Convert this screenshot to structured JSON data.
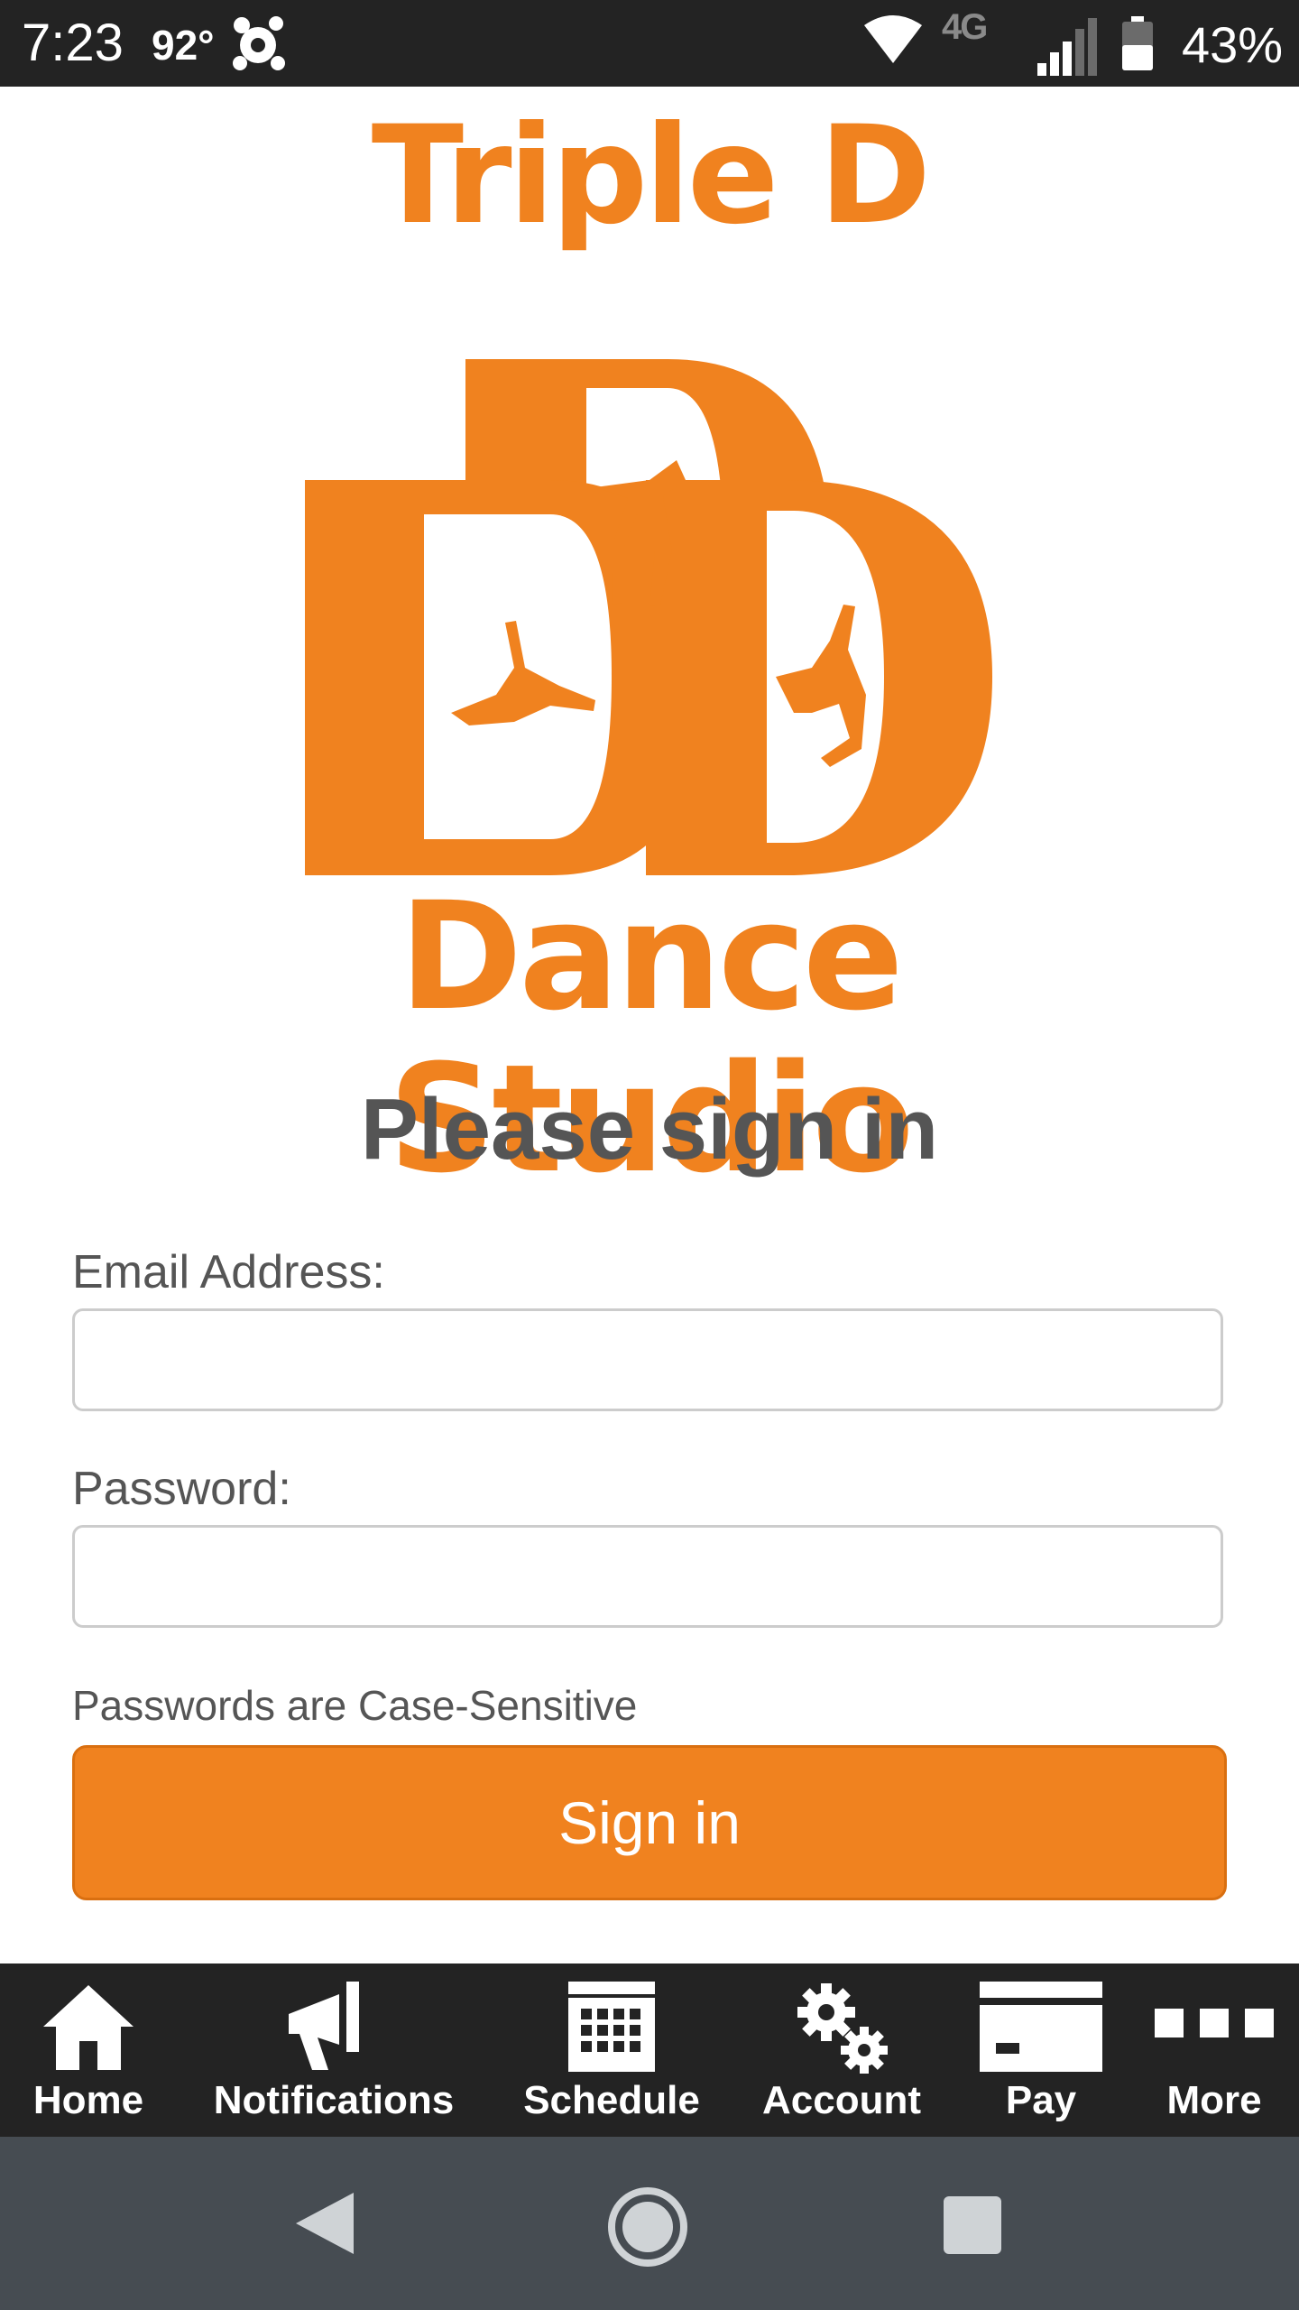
{
  "status_bar": {
    "time": "7:23",
    "temperature": "92°",
    "network": "4G",
    "battery_percent": "43%",
    "icons": [
      "app-notification-icon",
      "wifi-icon",
      "signal-icon",
      "battery-icon"
    ]
  },
  "logo": {
    "title_top": "Triple D",
    "title_bottom": "Dance Studio",
    "brand_color": "#f0821f"
  },
  "heading": "Please sign in",
  "form": {
    "email_label": "Email Address:",
    "email_value": "",
    "password_label": "Password:",
    "password_value": "",
    "hint": "Passwords are Case-Sensitive",
    "submit_label": "Sign in"
  },
  "bottom_nav": {
    "items": [
      {
        "label": "Home",
        "icon": "home-icon"
      },
      {
        "label": "Notifications",
        "icon": "megaphone-icon"
      },
      {
        "label": "Schedule",
        "icon": "calendar-icon"
      },
      {
        "label": "Account",
        "icon": "gears-icon"
      },
      {
        "label": "Pay",
        "icon": "credit-card-icon"
      },
      {
        "label": "More",
        "icon": "more-icon"
      }
    ]
  },
  "system_nav": {
    "icons": [
      "back-icon",
      "home-circle-icon",
      "recents-icon"
    ]
  }
}
